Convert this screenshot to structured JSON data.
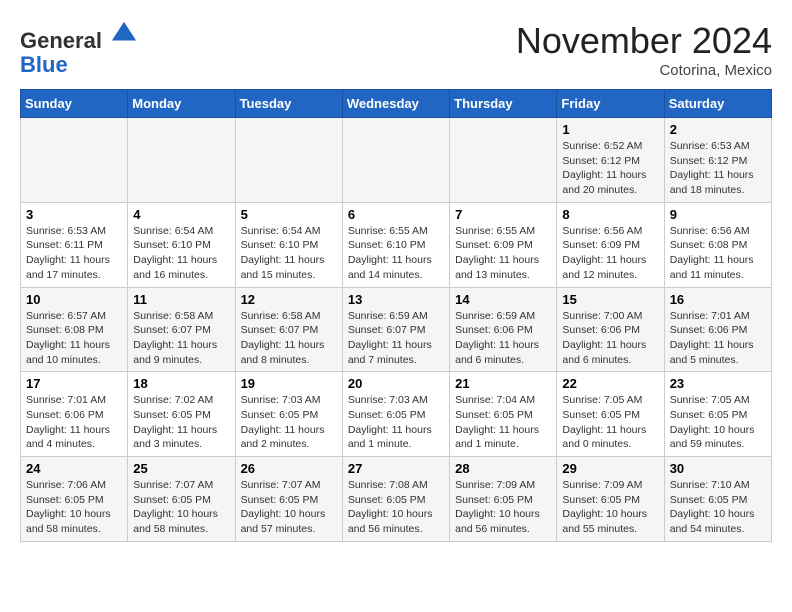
{
  "header": {
    "logo_line1": "General",
    "logo_line2": "Blue",
    "month": "November 2024",
    "location": "Cotorina, Mexico"
  },
  "weekdays": [
    "Sunday",
    "Monday",
    "Tuesday",
    "Wednesday",
    "Thursday",
    "Friday",
    "Saturday"
  ],
  "weeks": [
    [
      {
        "day": "",
        "info": ""
      },
      {
        "day": "",
        "info": ""
      },
      {
        "day": "",
        "info": ""
      },
      {
        "day": "",
        "info": ""
      },
      {
        "day": "",
        "info": ""
      },
      {
        "day": "1",
        "info": "Sunrise: 6:52 AM\nSunset: 6:12 PM\nDaylight: 11 hours and 20 minutes."
      },
      {
        "day": "2",
        "info": "Sunrise: 6:53 AM\nSunset: 6:12 PM\nDaylight: 11 hours and 18 minutes."
      }
    ],
    [
      {
        "day": "3",
        "info": "Sunrise: 6:53 AM\nSunset: 6:11 PM\nDaylight: 11 hours and 17 minutes."
      },
      {
        "day": "4",
        "info": "Sunrise: 6:54 AM\nSunset: 6:10 PM\nDaylight: 11 hours and 16 minutes."
      },
      {
        "day": "5",
        "info": "Sunrise: 6:54 AM\nSunset: 6:10 PM\nDaylight: 11 hours and 15 minutes."
      },
      {
        "day": "6",
        "info": "Sunrise: 6:55 AM\nSunset: 6:10 PM\nDaylight: 11 hours and 14 minutes."
      },
      {
        "day": "7",
        "info": "Sunrise: 6:55 AM\nSunset: 6:09 PM\nDaylight: 11 hours and 13 minutes."
      },
      {
        "day": "8",
        "info": "Sunrise: 6:56 AM\nSunset: 6:09 PM\nDaylight: 11 hours and 12 minutes."
      },
      {
        "day": "9",
        "info": "Sunrise: 6:56 AM\nSunset: 6:08 PM\nDaylight: 11 hours and 11 minutes."
      }
    ],
    [
      {
        "day": "10",
        "info": "Sunrise: 6:57 AM\nSunset: 6:08 PM\nDaylight: 11 hours and 10 minutes."
      },
      {
        "day": "11",
        "info": "Sunrise: 6:58 AM\nSunset: 6:07 PM\nDaylight: 11 hours and 9 minutes."
      },
      {
        "day": "12",
        "info": "Sunrise: 6:58 AM\nSunset: 6:07 PM\nDaylight: 11 hours and 8 minutes."
      },
      {
        "day": "13",
        "info": "Sunrise: 6:59 AM\nSunset: 6:07 PM\nDaylight: 11 hours and 7 minutes."
      },
      {
        "day": "14",
        "info": "Sunrise: 6:59 AM\nSunset: 6:06 PM\nDaylight: 11 hours and 6 minutes."
      },
      {
        "day": "15",
        "info": "Sunrise: 7:00 AM\nSunset: 6:06 PM\nDaylight: 11 hours and 6 minutes."
      },
      {
        "day": "16",
        "info": "Sunrise: 7:01 AM\nSunset: 6:06 PM\nDaylight: 11 hours and 5 minutes."
      }
    ],
    [
      {
        "day": "17",
        "info": "Sunrise: 7:01 AM\nSunset: 6:06 PM\nDaylight: 11 hours and 4 minutes."
      },
      {
        "day": "18",
        "info": "Sunrise: 7:02 AM\nSunset: 6:05 PM\nDaylight: 11 hours and 3 minutes."
      },
      {
        "day": "19",
        "info": "Sunrise: 7:03 AM\nSunset: 6:05 PM\nDaylight: 11 hours and 2 minutes."
      },
      {
        "day": "20",
        "info": "Sunrise: 7:03 AM\nSunset: 6:05 PM\nDaylight: 11 hours and 1 minute."
      },
      {
        "day": "21",
        "info": "Sunrise: 7:04 AM\nSunset: 6:05 PM\nDaylight: 11 hours and 1 minute."
      },
      {
        "day": "22",
        "info": "Sunrise: 7:05 AM\nSunset: 6:05 PM\nDaylight: 11 hours and 0 minutes."
      },
      {
        "day": "23",
        "info": "Sunrise: 7:05 AM\nSunset: 6:05 PM\nDaylight: 10 hours and 59 minutes."
      }
    ],
    [
      {
        "day": "24",
        "info": "Sunrise: 7:06 AM\nSunset: 6:05 PM\nDaylight: 10 hours and 58 minutes."
      },
      {
        "day": "25",
        "info": "Sunrise: 7:07 AM\nSunset: 6:05 PM\nDaylight: 10 hours and 58 minutes."
      },
      {
        "day": "26",
        "info": "Sunrise: 7:07 AM\nSunset: 6:05 PM\nDaylight: 10 hours and 57 minutes."
      },
      {
        "day": "27",
        "info": "Sunrise: 7:08 AM\nSunset: 6:05 PM\nDaylight: 10 hours and 56 minutes."
      },
      {
        "day": "28",
        "info": "Sunrise: 7:09 AM\nSunset: 6:05 PM\nDaylight: 10 hours and 56 minutes."
      },
      {
        "day": "29",
        "info": "Sunrise: 7:09 AM\nSunset: 6:05 PM\nDaylight: 10 hours and 55 minutes."
      },
      {
        "day": "30",
        "info": "Sunrise: 7:10 AM\nSunset: 6:05 PM\nDaylight: 10 hours and 54 minutes."
      }
    ]
  ]
}
